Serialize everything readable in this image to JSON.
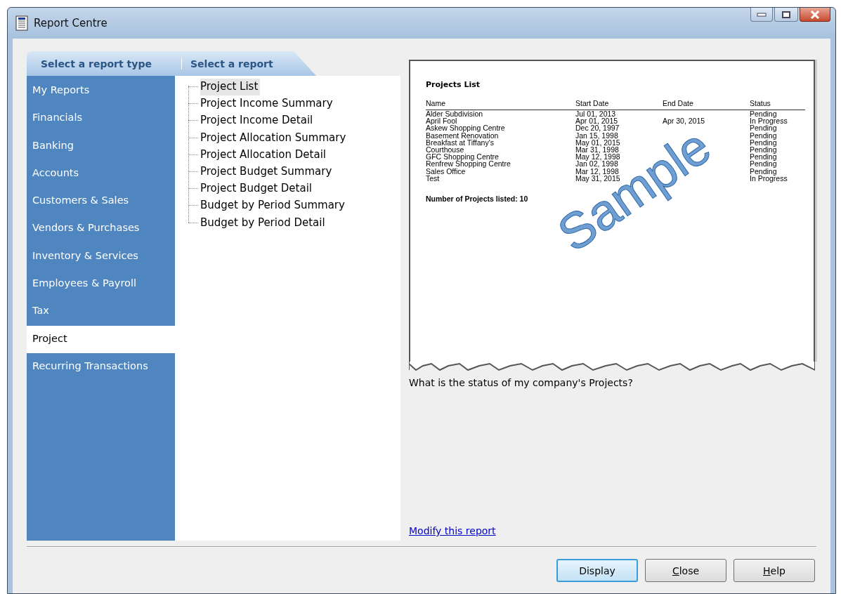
{
  "window": {
    "title": "Report Centre"
  },
  "tabs": [
    {
      "label": "Select a report type"
    },
    {
      "label": "Select a report"
    }
  ],
  "report_types": [
    {
      "label": "My Reports",
      "selected": false
    },
    {
      "label": "Financials",
      "selected": false
    },
    {
      "label": "Banking",
      "selected": false
    },
    {
      "label": "Accounts",
      "selected": false
    },
    {
      "label": "Customers & Sales",
      "selected": false
    },
    {
      "label": "Vendors & Purchases",
      "selected": false
    },
    {
      "label": "Inventory & Services",
      "selected": false
    },
    {
      "label": "Employees & Payroll",
      "selected": false
    },
    {
      "label": "Tax",
      "selected": false
    },
    {
      "label": "Project",
      "selected": true
    },
    {
      "label": "Recurring Transactions",
      "selected": false
    }
  ],
  "reports": [
    {
      "label": "Project List",
      "selected": true
    },
    {
      "label": "Project Income Summary",
      "selected": false
    },
    {
      "label": "Project Income Detail",
      "selected": false
    },
    {
      "label": "Project Allocation Summary",
      "selected": false
    },
    {
      "label": "Project Allocation Detail",
      "selected": false
    },
    {
      "label": "Project Budget Summary",
      "selected": false
    },
    {
      "label": "Project Budget Detail",
      "selected": false
    },
    {
      "label": "Budget by Period Summary",
      "selected": false
    },
    {
      "label": "Budget by Period Detail",
      "selected": false
    }
  ],
  "preview": {
    "title": "Projects List",
    "columns": [
      "Name",
      "Start Date",
      "End Date",
      "Status"
    ],
    "rows": [
      [
        "Alder Subdivision",
        "Jul 01, 2013",
        "",
        "Pending"
      ],
      [
        "April Fool",
        "Apr 01, 2015",
        "Apr 30, 2015",
        "In Progress"
      ],
      [
        "Askew Shopping Centre",
        "Dec 20, 1997",
        "",
        "Pending"
      ],
      [
        "Basement Renovation",
        "Jan 15, 1998",
        "",
        "Pending"
      ],
      [
        "Breakfast at Tiffany's",
        "May 01, 2015",
        "",
        "Pending"
      ],
      [
        "Courthouse",
        "Mar 31, 1998",
        "",
        "Pending"
      ],
      [
        "GFC Shopping Centre",
        "May 12, 1998",
        "",
        "Pending"
      ],
      [
        "Renfrew Shopping Centre",
        "Jan 02, 1998",
        "",
        "Pending"
      ],
      [
        "Sales Office",
        "Mar 12, 1998",
        "",
        "Pending"
      ],
      [
        "Test",
        "May 31, 2015",
        "",
        "In Progress"
      ]
    ],
    "footer": "Number of Projects listed: 10",
    "stamp": "Sample"
  },
  "description": "What is the status of my company's Projects?",
  "modify_link": "Modify this report",
  "buttons": [
    {
      "label": "Display",
      "default": true,
      "underline_first": false
    },
    {
      "label": "Close",
      "default": false,
      "underline_first": true
    },
    {
      "label": "Help",
      "default": false,
      "underline_first": true
    }
  ]
}
